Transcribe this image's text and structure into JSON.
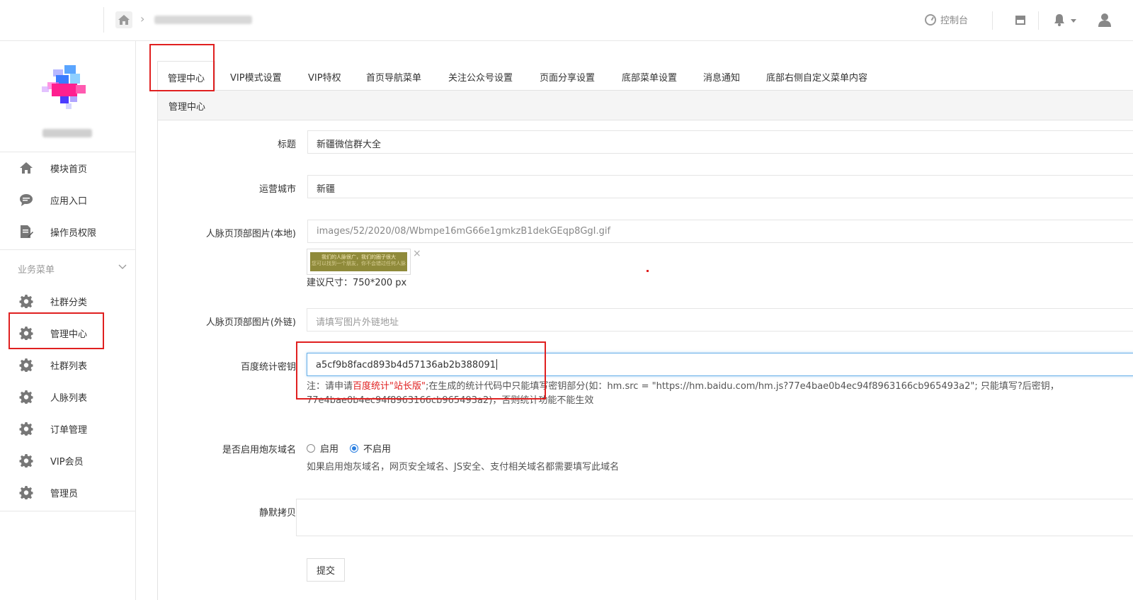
{
  "topbar": {
    "console_label": "控制台"
  },
  "sidebar": {
    "top_items": [
      {
        "label": "模块首页",
        "icon": "home-icon"
      },
      {
        "label": "应用入口",
        "icon": "chat-icon"
      },
      {
        "label": "操作员权限",
        "icon": "document-edit-icon"
      }
    ],
    "group_label": "业务菜单",
    "group_items": [
      {
        "label": "社群分类"
      },
      {
        "label": "管理中心"
      },
      {
        "label": "社群列表"
      },
      {
        "label": "人脉列表"
      },
      {
        "label": "订单管理"
      },
      {
        "label": "VIP会员"
      },
      {
        "label": "管理员"
      }
    ]
  },
  "tabs": [
    {
      "label": "管理中心",
      "active": true
    },
    {
      "label": "VIP模式设置"
    },
    {
      "label": "VIP特权"
    },
    {
      "label": "首页导航菜单"
    },
    {
      "label": "关注公众号设置"
    },
    {
      "label": "页面分享设置"
    },
    {
      "label": "底部菜单设置"
    },
    {
      "label": "消息通知"
    },
    {
      "label": "底部右侧自定义菜单内容"
    }
  ],
  "panel": {
    "title": "管理中心"
  },
  "form": {
    "title": {
      "label": "标题",
      "value": "新疆微信群大全"
    },
    "city": {
      "label": "运营城市",
      "value": "新疆"
    },
    "image_local": {
      "label": "人脉页顶部图片(本地)",
      "value": "images/52/2020/08/Wbmpe16mG66e1gmkzB1dekGEqp8GgI.gif",
      "thumb_text_1": "我们的人脉很广，我们的圈子很大",
      "thumb_text_2": "您可以找到一个朋友，你不会错过任何人脉",
      "remove": "×",
      "size_hint": "建议尺寸：750*200 px"
    },
    "image_link": {
      "label": "人脉页顶部图片(外链)",
      "placeholder": "请填写图片外链地址"
    },
    "baidu_key": {
      "label": "百度统计密钥",
      "value": "a5cf9b8facd893b4d57136ab2b388091",
      "note_prefix": "注：请申请",
      "note_link": "百度统计\"站长版\"",
      "note_suffix": ";在生成的统计代码中只能填写密钥部分(如：hm.src = \"https://hm.baidu.com/hm.js?77e4bae0b4ec94f8963166cb965493a2\"; 只能填写?后密钥，77e4bae0b4ec94f8963166cb965493a2)，否则统计功能不能生效"
    },
    "cannon_domain": {
      "label": "是否启用炮灰域名",
      "option_on": "启用",
      "option_off": "不启用",
      "selected": "不启用",
      "hint": "如果启用炮灰域名，网页安全域名、JS安全、支付相关域名都需要填写此域名"
    },
    "silent_copy": {
      "label": "静默拷贝",
      "value": ""
    },
    "submit_label": "提交"
  },
  "colors": {
    "accent": "#2b7fe0",
    "annotation": "#e02020",
    "note_link": "#e02020"
  }
}
